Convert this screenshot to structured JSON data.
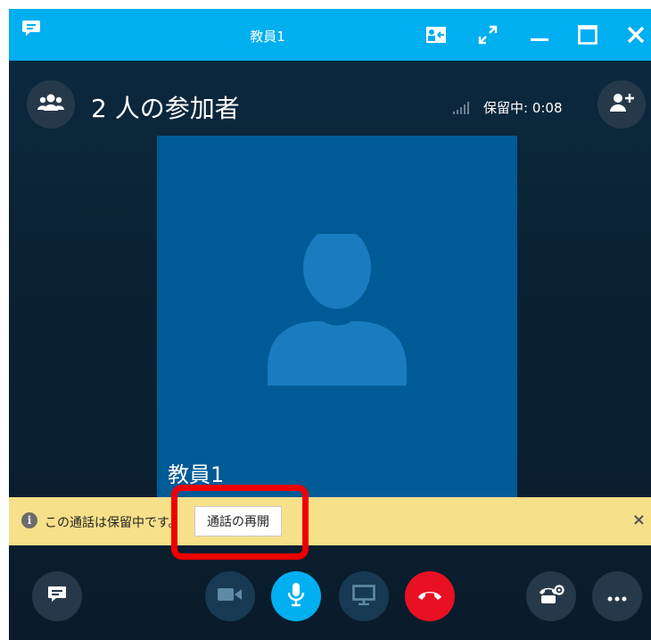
{
  "window": {
    "title": "教員1"
  },
  "header": {
    "participants_label": "2 人の参加者",
    "hold_status": "保留中: 0:08"
  },
  "video": {
    "participant_name": "教員1"
  },
  "hold_bar": {
    "message": "この通話は保留中です。",
    "resume_label": "通話の再開",
    "close_glyph": "×"
  },
  "colors": {
    "titlebar": "#00aff0",
    "tile": "#005a95",
    "hold_bar": "#f7e08a",
    "mic_active": "#00aff0",
    "end_call": "#e81123",
    "highlight": "#ee0000"
  },
  "icons": [
    "chat-icon",
    "pop-out-icon",
    "fullscreen-icon",
    "minimize-icon",
    "maximize-icon",
    "close-icon",
    "participants-icon",
    "signal-icon",
    "add-person-icon",
    "avatar-placeholder-icon",
    "info-icon",
    "video-icon",
    "microphone-icon",
    "screen-share-icon",
    "end-call-icon",
    "dialpad-icon",
    "more-icon"
  ]
}
